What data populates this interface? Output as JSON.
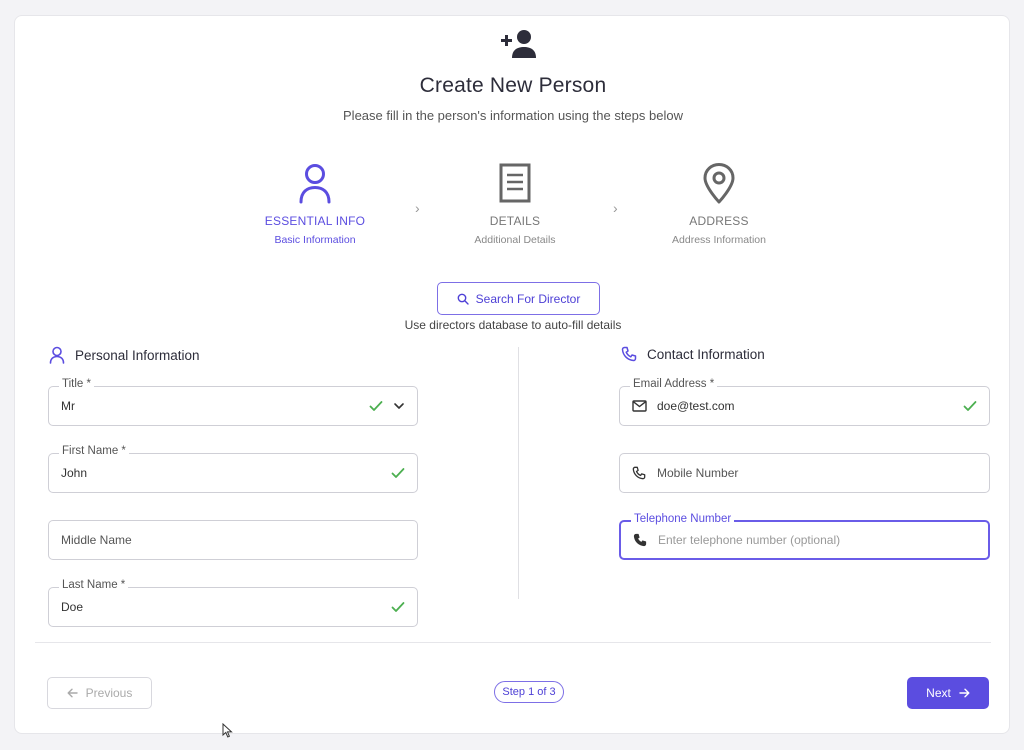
{
  "header": {
    "icon": "add-user-icon",
    "title": "Create New Person",
    "subtitle": "Please fill in the person's information using the steps below"
  },
  "stepper": {
    "steps": [
      {
        "label": "ESSENTIAL INFO",
        "sub": "Basic Information",
        "icon": "user-icon",
        "active": true
      },
      {
        "label": "DETAILS",
        "sub": "Additional Details",
        "icon": "document-icon",
        "active": false
      },
      {
        "label": "ADDRESS",
        "sub": "Address Information",
        "icon": "location-pin-icon",
        "active": false
      }
    ]
  },
  "director": {
    "button_label": "Search For Director",
    "hint": "Use directors database to auto-fill details"
  },
  "personal": {
    "heading": "Personal Information",
    "title": {
      "label": "Title *",
      "value": "Mr"
    },
    "first_name": {
      "label": "First Name *",
      "value": "John"
    },
    "middle_name": {
      "placeholder": "Middle Name"
    },
    "last_name": {
      "label": "Last Name *",
      "value": "Doe"
    }
  },
  "contact": {
    "heading": "Contact Information",
    "email": {
      "label": "Email Address *",
      "value": "doe@test.com"
    },
    "mobile": {
      "placeholder": "Mobile Number"
    },
    "telephone": {
      "label": "Telephone Number",
      "placeholder": "Enter telephone number (optional)"
    }
  },
  "footer": {
    "previous_label": "Previous",
    "step_indicator": "Step 1 of 3",
    "next_label": "Next"
  },
  "colors": {
    "accent": "#5b4de0",
    "success": "#4caf50",
    "icon_dark": "#2d2d3a"
  }
}
